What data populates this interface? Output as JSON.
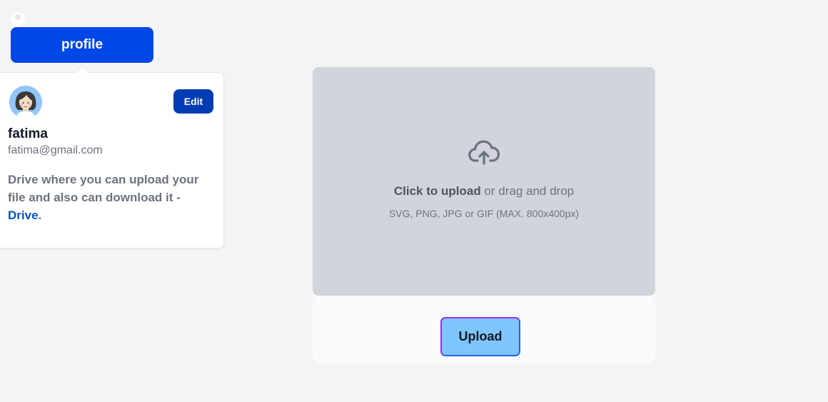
{
  "header": {
    "profile_button_label": "profile",
    "user_icon": "user-icon"
  },
  "profile_card": {
    "avatar_icon": "avatar-woman",
    "edit_label": "Edit",
    "name": "fatima",
    "email": "fatima@gmail.com",
    "description": "Drive where you can upload your file and also can download it - ",
    "link_text": "Drive",
    "description_end": "."
  },
  "uploader": {
    "icon": "cloud-upload-icon",
    "click_text_bold": "Click to upload",
    "click_text_rest": " or drag and drop",
    "formats": "SVG, PNG, JPG or GIF (MAX. 800x400px)",
    "upload_label": "Upload"
  },
  "colors": {
    "primary": "#0047e8",
    "edit_button": "#003cb3",
    "dropzone": "#d1d5db",
    "upload_button": "#7dc6ff",
    "link": "#0052cc",
    "background": "#f3f4f6"
  }
}
